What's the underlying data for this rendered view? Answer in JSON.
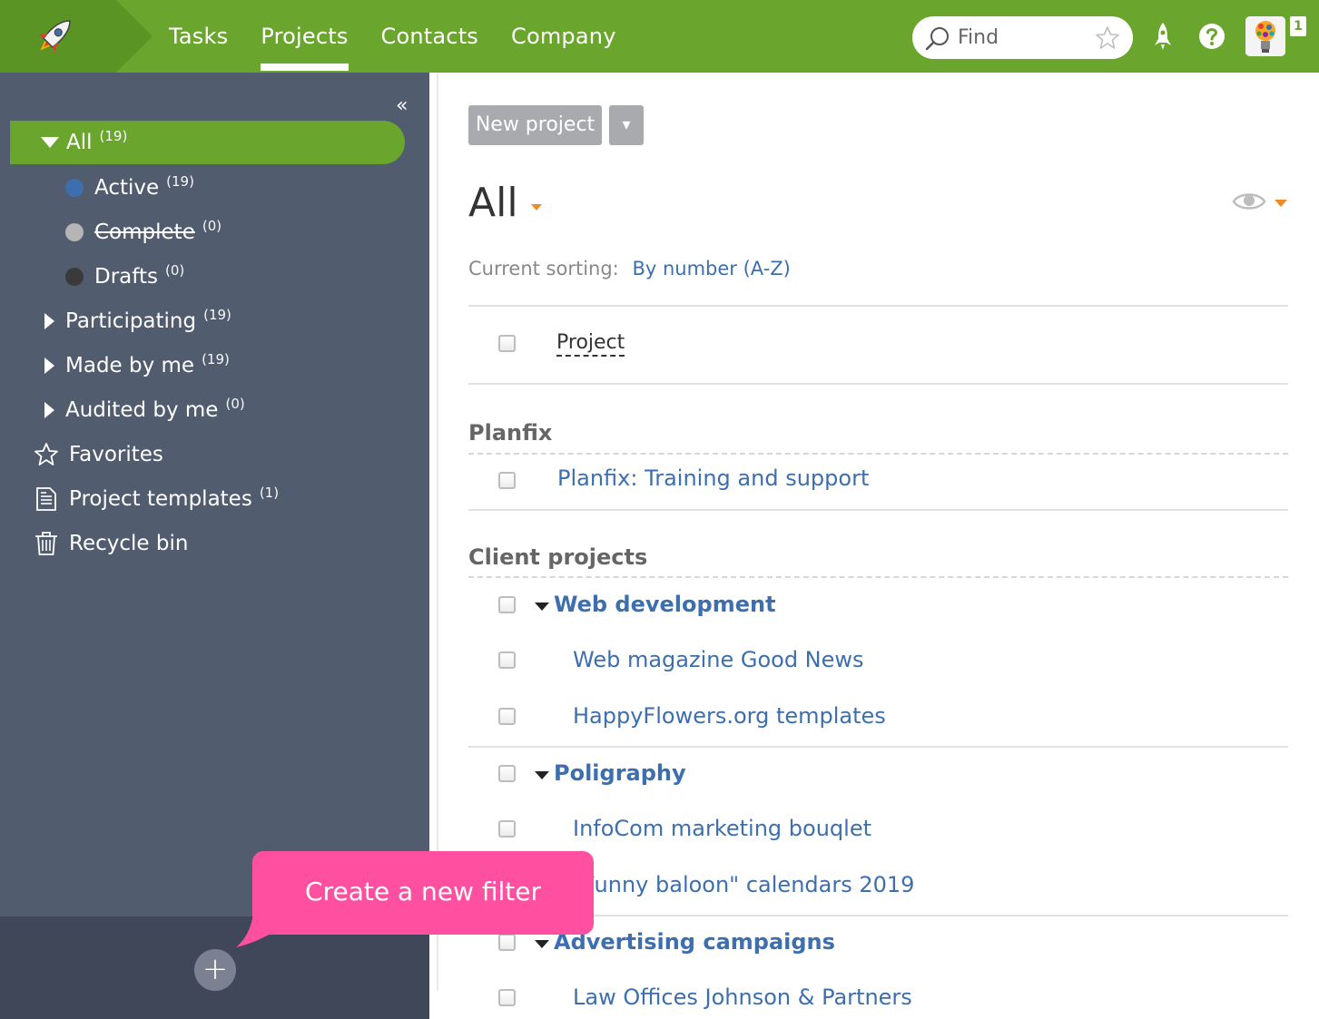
{
  "nav": {
    "items": [
      {
        "label": "Tasks",
        "active": false
      },
      {
        "label": "Projects",
        "active": true
      },
      {
        "label": "Contacts",
        "active": false
      },
      {
        "label": "Company",
        "active": false
      }
    ]
  },
  "search": {
    "placeholder": "Find"
  },
  "header": {
    "notification_count": "1"
  },
  "sidebar": {
    "all": {
      "label": "All",
      "count": "(19)"
    },
    "items": [
      {
        "label": "Active",
        "count": "(19)",
        "dot_color": "#3d6fae"
      },
      {
        "label": "Complete",
        "count": "(0)",
        "dot_color": "#b5b5b5"
      },
      {
        "label": "Drafts",
        "count": "(0)",
        "dot_color": "#3a3a3a"
      },
      {
        "label": "Participating",
        "count": "(19)"
      },
      {
        "label": "Made by me",
        "count": "(19)"
      },
      {
        "label": "Audited by me",
        "count": "(0)"
      },
      {
        "label": "Favorites",
        "count": ""
      },
      {
        "label": "Project templates",
        "count": "(1)"
      },
      {
        "label": "Recycle bin",
        "count": ""
      }
    ]
  },
  "tooltip": {
    "text": "Create a new filter"
  },
  "toolbar": {
    "new_project_label": "New project",
    "dropdown_label": "▾"
  },
  "main": {
    "title": "All",
    "sorting_label": "Current sorting:",
    "sorting_value": "By number (A-Z)",
    "column_header": "Project",
    "groups": [
      {
        "name": "Planfix"
      },
      {
        "name": "Client projects"
      }
    ],
    "rows": [
      {
        "label": "Planfix: Training and support"
      },
      {
        "label": "Web development"
      },
      {
        "label": "Web magazine Good News"
      },
      {
        "label": "HappyFlowers.org templates"
      },
      {
        "label": "Poligraphy"
      },
      {
        "label": "InfoCom marketing bouqlet"
      },
      {
        "label": "\"Funny baloon\" calendars 2019"
      },
      {
        "label": "Advertising campaigns"
      },
      {
        "label": "Law Offices Johnson & Partners"
      }
    ]
  },
  "colors": {
    "brand_green": "#6aa62d",
    "sidebar_bg": "#525c6f",
    "link_blue": "#3d6fae",
    "tooltip_pink": "#ff4fa0",
    "accent_orange": "#f08a24"
  }
}
